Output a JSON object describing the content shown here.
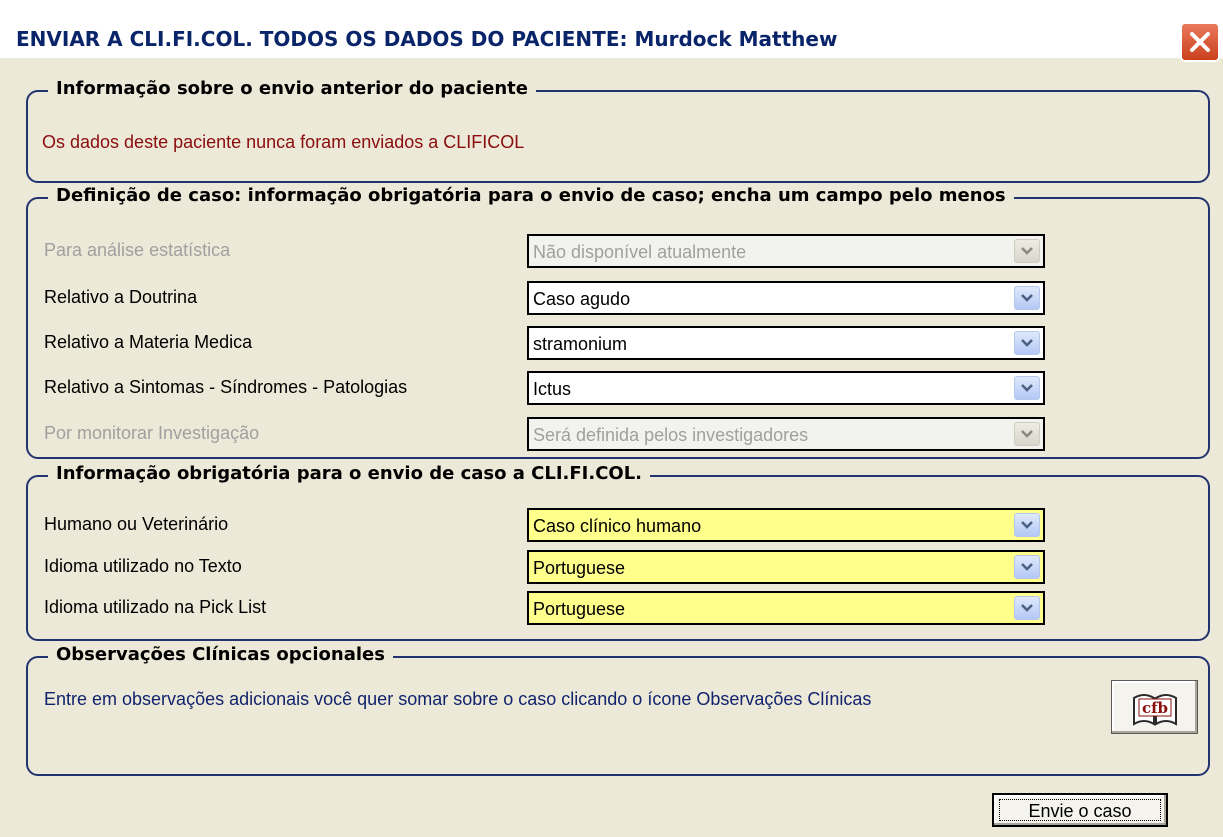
{
  "window": {
    "title": "ENVIAR A CLI.FI.COL. TODOS OS DADOS DO PACIENTE: Murdock Matthew"
  },
  "previous": {
    "legend": "Informação sobre o envio anterior do paciente",
    "message": "Os dados deste paciente nunca foram enviados a CLIFICOL"
  },
  "definition": {
    "legend": "Definição de caso: informação obrigatória para o envio de caso; encha um campo pelo menos",
    "rows": [
      {
        "label": "Para análise estatística",
        "value": "Não disponível atualmente",
        "enabled": false
      },
      {
        "label": "Relativo a Doutrina",
        "value": "Caso agudo",
        "enabled": true
      },
      {
        "label": "Relativo a Materia Medica",
        "value": "stramonium",
        "enabled": true
      },
      {
        "label": "Relativo a Sintomas - Síndromes - Patologias",
        "value": "Ictus",
        "enabled": true
      },
      {
        "label": "Por monitorar Investigação",
        "value": "Será definida pelos investigadores",
        "enabled": false
      }
    ]
  },
  "required": {
    "legend": "Informação obrigatória para o envio de caso a CLI.FI.COL.",
    "rows": [
      {
        "label": "Humano ou Veterinário",
        "value": "Caso clínico humano"
      },
      {
        "label": "Idioma utilizado no Texto",
        "value": "Portuguese"
      },
      {
        "label": "Idioma utilizado na Pick List",
        "value": "Portuguese"
      }
    ]
  },
  "observations": {
    "legend": "Observações Clínicas opcionales",
    "text": "Entre em observações adicionais você quer somar sobre o caso clicando o ícone Observações Clínicas",
    "icon_text": "cfb"
  },
  "actions": {
    "send_label": "Envie o caso"
  },
  "colors": {
    "title": "#0a246a",
    "group_border": "#23336f",
    "required_field": "#ffff8c",
    "notice_text": "#8b0d0d",
    "info_text": "#12236e",
    "close_button": "#c9401c"
  }
}
